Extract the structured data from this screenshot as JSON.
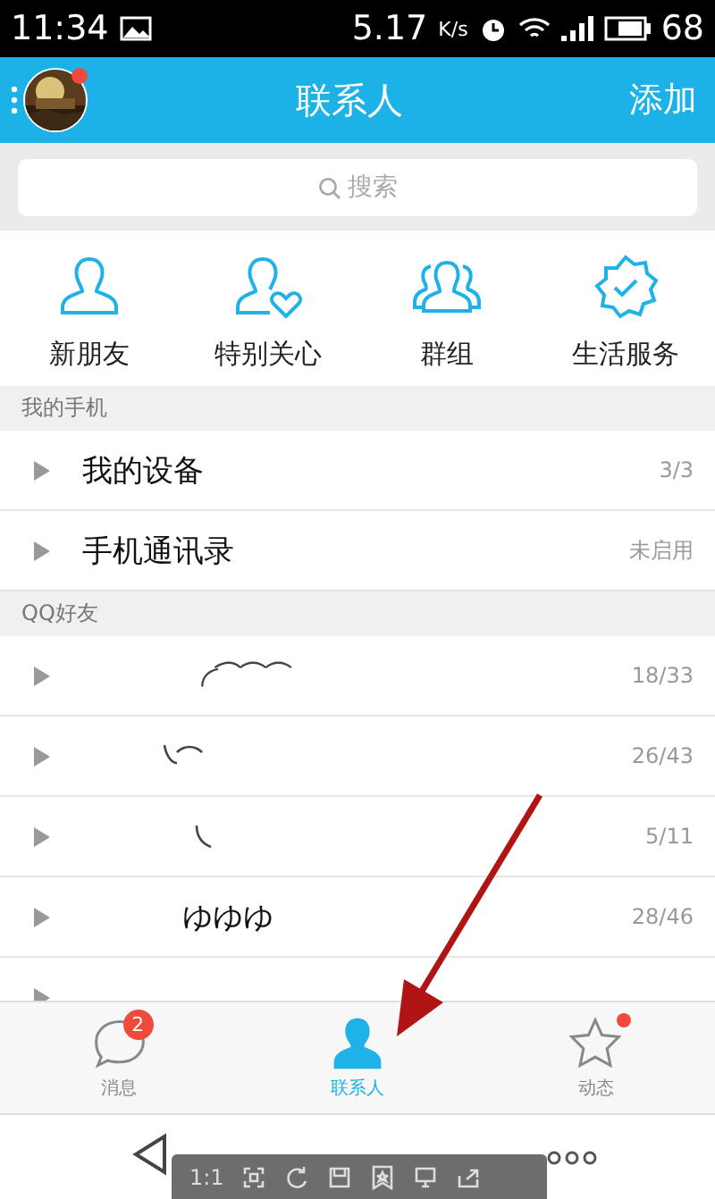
{
  "status_bar": {
    "time": "11:34",
    "speed": "5.17",
    "speed_unit": "K/s",
    "battery": "68"
  },
  "header": {
    "title": "联系人",
    "action": "添加",
    "avatar_badge": true
  },
  "search": {
    "placeholder": "搜索"
  },
  "shortcuts": [
    {
      "kind": "person",
      "label": "新朋友"
    },
    {
      "kind": "heart",
      "label": "特别关心"
    },
    {
      "kind": "group",
      "label": "群组"
    },
    {
      "kind": "badge",
      "label": "生活服务"
    }
  ],
  "sections": [
    {
      "title": "我的手机",
      "rows": [
        {
          "kind": "text",
          "name": "我的设备",
          "count": "3/3"
        },
        {
          "kind": "text",
          "name": "手机通讯录",
          "count": "未启用"
        }
      ]
    },
    {
      "title": "QQ好友",
      "rows": [
        {
          "kind": "wave",
          "count": "18/33"
        },
        {
          "kind": "hook",
          "count": "26/43"
        },
        {
          "kind": "tick",
          "count": "5/11"
        },
        {
          "kind": "text",
          "name": "ゆゆゆ",
          "count": "28/46"
        },
        {
          "kind": "blank"
        }
      ]
    }
  ],
  "tabs": [
    {
      "kind": "chat",
      "label": "消息",
      "badge": "2",
      "dot": false,
      "selected": false
    },
    {
      "kind": "contacts",
      "label": "联系人",
      "dot": false,
      "selected": true
    },
    {
      "kind": "star",
      "label": "动态",
      "dot": true,
      "selected": false
    }
  ],
  "viewer_toolbar": {
    "zoom_label": "1:1"
  }
}
